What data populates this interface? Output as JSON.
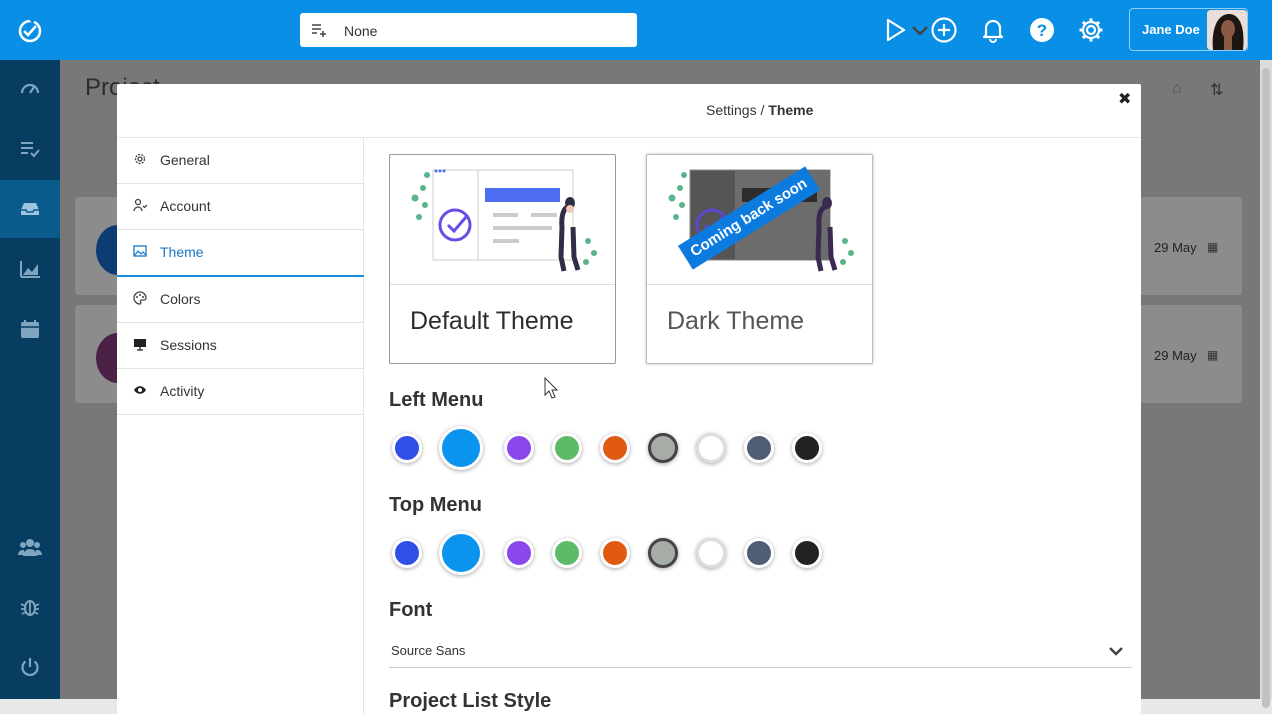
{
  "topbar": {
    "project_value": "None",
    "user_name": "Jane Doe",
    "icons": [
      "app-logo-icon",
      "add-to-list-icon",
      "chevron-down-icon",
      "play-icon",
      "plus-circle-icon",
      "bell-icon",
      "help-icon",
      "gear-icon"
    ]
  },
  "sidebar": {
    "icons": [
      "dashboard-icon",
      "task-list-icon",
      "inbox-icon",
      "reports-chart-icon",
      "calendar-icon",
      "team-icon",
      "bug-icon",
      "power-icon"
    ],
    "active": "inbox-icon"
  },
  "background": {
    "page_title": "Project",
    "dates": [
      "29 May",
      "29 May"
    ]
  },
  "modal": {
    "breadcrumb_parent": "Settings / ",
    "breadcrumb_current": "Theme",
    "close_label": "✖",
    "nav": [
      {
        "label": "General",
        "icon": "gear-icon"
      },
      {
        "label": "Account",
        "icon": "account-icon"
      },
      {
        "label": "Theme",
        "icon": "image-icon",
        "active": true
      },
      {
        "label": "Colors",
        "icon": "palette-icon"
      },
      {
        "label": "Sessions",
        "icon": "monitor-icon"
      },
      {
        "label": "Activity",
        "icon": "eye-icon"
      }
    ],
    "themes": {
      "default_name": "Default Theme",
      "dark_name": "Dark Theme",
      "dark_ribbon": "Coming back soon"
    },
    "left_menu_title": "Left Menu",
    "top_menu_title": "Top Menu",
    "font_title": "Font",
    "font_value": "Source Sans",
    "next_section_title": "Project List Style",
    "swatch_colors": [
      "#2f4fe6",
      "#0a94ee",
      "#8b47ec",
      "#5dba68",
      "#e05a12",
      "#a6aca6",
      "#ffffff",
      "#4f5d75",
      "#222222"
    ],
    "selected_swatch_index": 1
  }
}
